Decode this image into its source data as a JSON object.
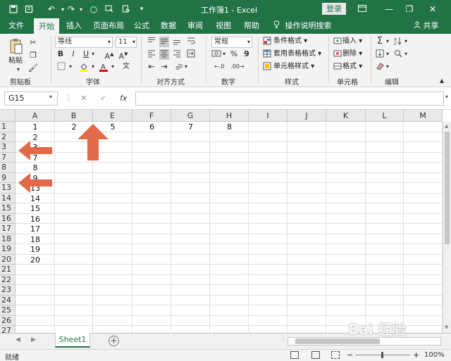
{
  "titlebar": {
    "title": "工作簿1 - Excel",
    "login": "登录",
    "bg_color": "#217346"
  },
  "tabs": [
    "文件",
    "开始",
    "插入",
    "页面布局",
    "公式",
    "数据",
    "审阅",
    "视图",
    "帮助"
  ],
  "tell_me": "操作说明搜索",
  "share": "共享",
  "ribbon": {
    "clipboard": {
      "paste": "粘贴",
      "group": "剪贴板"
    },
    "font": {
      "font_name": "等线",
      "font_size": "11",
      "group": "字体",
      "bold": "B",
      "italic": "I",
      "underline": "U"
    },
    "alignment": {
      "group": "对齐方式"
    },
    "number": {
      "format": "常规",
      "percent": "%",
      "comma": "9",
      "group": "数字"
    },
    "styles": {
      "conditional": "条件格式",
      "table": "套用表格格式",
      "cell_styles": "单元格样式",
      "group": "样式"
    },
    "cells": {
      "insert": "插入",
      "delete": "删除",
      "format": "格式",
      "group": "单元格"
    },
    "editing": {
      "group": "编辑"
    }
  },
  "formula_bar": {
    "name_box": "G15",
    "fx": "fx",
    "cancel": "✕",
    "enter": "✓",
    "content": ""
  },
  "grid": {
    "columns": [
      "A",
      "B",
      "E",
      "F",
      "G",
      "H",
      "I",
      "J",
      "K",
      "L",
      "M"
    ],
    "rows": [
      "1",
      "2",
      "3",
      "7",
      "8",
      "9",
      "13",
      "14",
      "15",
      "16",
      "17",
      "18",
      "19",
      "20",
      "21",
      "22",
      "23",
      "24",
      "25",
      "26",
      "27"
    ],
    "row1_values": [
      "1",
      "2",
      "5",
      "6",
      "7",
      "8"
    ],
    "colA_values": [
      "1",
      "2",
      "3",
      "7",
      "8",
      "9",
      "13",
      "14",
      "15",
      "16",
      "17",
      "18",
      "19",
      "20"
    ]
  },
  "sheets": {
    "active": "Sheet1",
    "add": "+"
  },
  "status": {
    "ready": "就绪",
    "zoom": "100%"
  },
  "annotation_color": "#e06a4a",
  "watermark": "Bai 经验"
}
